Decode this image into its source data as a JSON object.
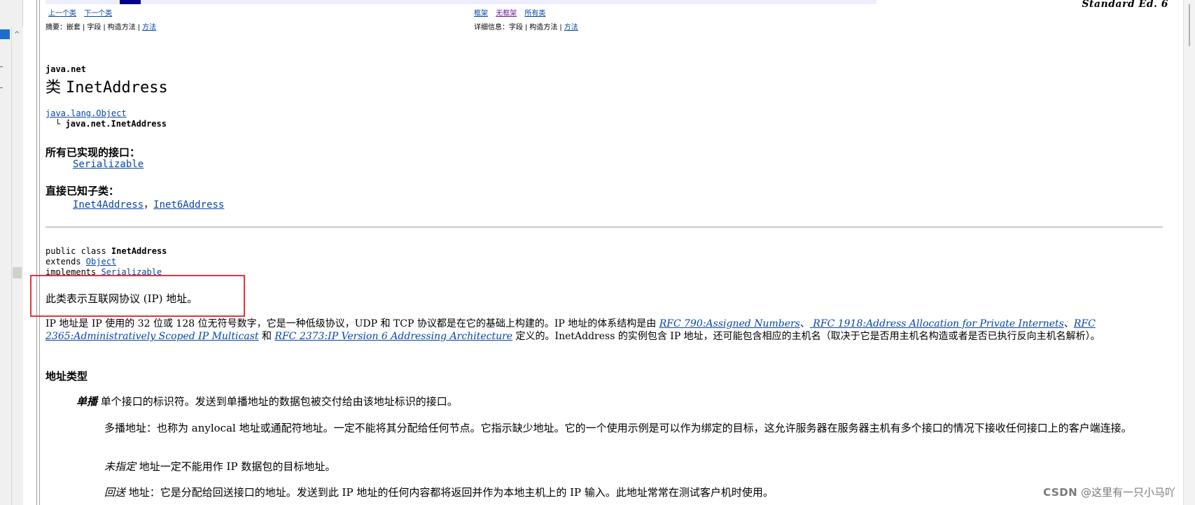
{
  "edition": "Standard Ed. 6",
  "nav": {
    "prev_class": "上一个类",
    "next_class": "下一个类",
    "frames": "框架",
    "no_frames": "无框架",
    "all_classes": "所有类"
  },
  "summary_row": {
    "label": "摘要：",
    "nested": "嵌套",
    "field": "字段",
    "constructor": "构造方法",
    "method": "方法"
  },
  "detail_row": {
    "label": "详细信息：",
    "field": "字段",
    "constructor": "构造方法",
    "method": "方法"
  },
  "package": "java.net",
  "title_prefix": "类",
  "class_name": "InetAddress",
  "hierarchy": {
    "parent": "java.lang.Object",
    "child_prefix": "└",
    "child": "java.net.InetAddress"
  },
  "implemented_interfaces": {
    "label": "所有已实现的接口：",
    "items": [
      "Serializable"
    ]
  },
  "known_subclasses": {
    "label": "直接已知子类：",
    "items": [
      "Inet4Address",
      "Inet6Address"
    ],
    "sep": "，"
  },
  "signature": {
    "line1_prefix": "public class ",
    "line1_name": "InetAddress",
    "line2_prefix": "extends ",
    "line2_link": "Object",
    "line3_prefix": "implements ",
    "line3_link": "Serializable"
  },
  "intro": "此类表示互联网协议 (IP) 地址。",
  "description": {
    "part1": "IP 地址是 IP 使用的 32 位或 128 位无符号数字，它是一种低级协议，UDP 和 TCP 协议都是在它的基础上构建的。IP 地址的体系结构是由 ",
    "rfc790": "RFC 790:Assigned Numbers",
    "sep1": "、",
    "rfc1918": " RFC 1918:Address Allocation for Private Internets",
    "sep2": "、",
    "rfc2365": "RFC 2365:Administratively Scoped IP Multicast",
    "and": " 和 ",
    "rfc2373": "RFC 2373:IP Version 6 Addressing Architecture",
    "part2": " 定义的。InetAddress 的实例包含 IP 地址，还可能包含相应的主机名（取决于它是否用主机名构造或者是否已执行反向主机名解析）。"
  },
  "address_types": {
    "heading": "地址类型",
    "unicast_term": "单播",
    "unicast_text": " 单个接口的标识符。发送到单播地址的数据包被交付给由该地址标识的接口。",
    "multicast_text": "多播地址：也称为 anylocal 地址或通配符地址。一定不能将其分配给任何节点。它指示缺少地址。它的一个使用示例是可以作为绑定的目标，这允许服务器在服务器主机有多个接口的情况下接收任何接口上的客户端连接。",
    "unspecified_term": "未指定",
    "unspecified_text": " 地址一定不能用作 IP 数据包的目标地址。",
    "loopback_term": "回送",
    "loopback_text": " 地址：它是分配给回送接口的地址。发送到此 IP 地址的任何内容都将返回并作为本地主机上的 IP 输入。此地址常常在测试客户机时使用。"
  },
  "watermark": {
    "brand": "CSDN",
    "author": " @这里有一只小马吖"
  }
}
